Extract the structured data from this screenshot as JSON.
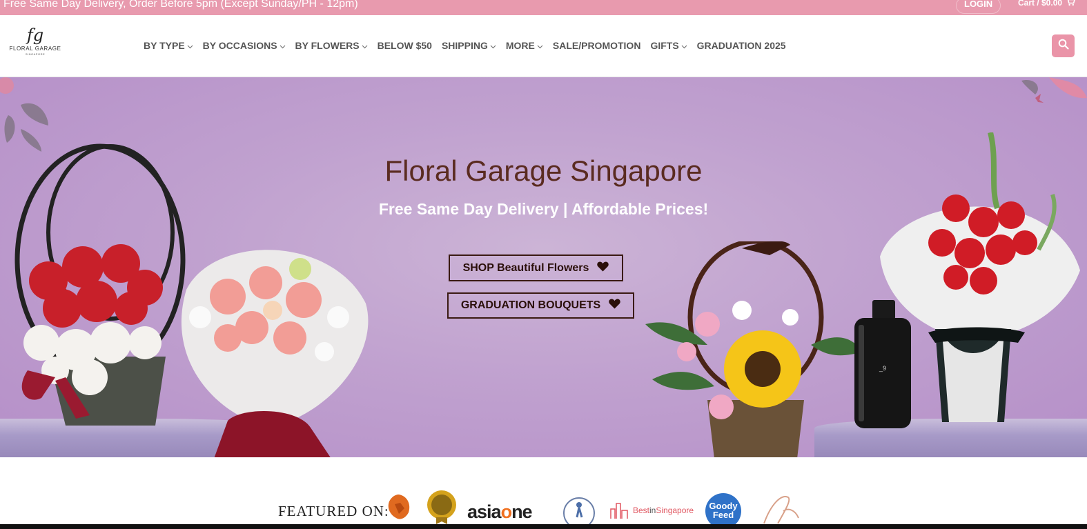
{
  "topbar": {
    "promo": "Free Same Day Delivery, Order Before 5pm (Except Sunday/PH - 12pm)",
    "login": "LOGIN",
    "cart": "Cart / $0.00",
    "cart_icon": "cart-icon"
  },
  "header": {
    "logo": {
      "monogram": "fg",
      "brand": "FLORAL GARAGE",
      "sub": "SINGAPORE"
    },
    "nav": [
      {
        "label": "BY TYPE",
        "dropdown": true
      },
      {
        "label": "BY OCCASIONS",
        "dropdown": true
      },
      {
        "label": "BY FLOWERS",
        "dropdown": true
      },
      {
        "label": "BELOW $50",
        "dropdown": false
      },
      {
        "label": "SHIPPING",
        "dropdown": true
      },
      {
        "label": "MORE",
        "dropdown": true
      },
      {
        "label": "SALE/PROMOTION",
        "dropdown": false
      },
      {
        "label": "GIFTS",
        "dropdown": true
      },
      {
        "label": "GRADUATION 2025",
        "dropdown": false
      }
    ],
    "search_icon": "search-icon"
  },
  "hero": {
    "title": "Floral Garage Singapore",
    "subtitle": "Free Same Day Delivery | Affordable Prices!",
    "buttons": [
      {
        "label": "SHOP Beautiful Flowers",
        "icon": "heart-icon"
      },
      {
        "label": "GRADUATION BOUQUETS",
        "icon": "heart-icon"
      }
    ]
  },
  "featured": {
    "label": "FEATURED ON:",
    "logos": [
      "lion-logo",
      "award-seal-logo",
      "asiaone",
      "the-smart-local-logo",
      "BestinSingapore",
      "Goody Feed",
      "script-logo"
    ],
    "asiaone_a": "asia",
    "asiaone_o": "o",
    "asiaone_b": "ne",
    "bis_a": "Best",
    "bis_b": "in",
    "bis_c": "Singapore",
    "goody1": "Goody",
    "goody2": "Feed"
  },
  "colors": {
    "topbar": "#e89aae",
    "accent": "#ea94a8",
    "hero_title": "#5a2b20",
    "hero_bg": "#c0a1cf"
  }
}
